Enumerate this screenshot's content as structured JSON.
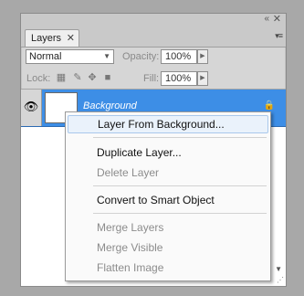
{
  "panel": {
    "tab_label": "Layers",
    "tab_close": "✕",
    "collapse_glyph": "«",
    "close_glyph": "✕",
    "menu_glyph": "▾≡"
  },
  "controls": {
    "blend_mode": "Normal",
    "opacity_label": "Opacity:",
    "opacity_value": "100%",
    "lock_label": "Lock:",
    "fill_label": "Fill:",
    "fill_value": "100%"
  },
  "layers": [
    {
      "name": "Background",
      "visible": true,
      "locked": true,
      "selected": true
    }
  ],
  "context_menu": {
    "items": [
      {
        "label": "Layer From Background...",
        "enabled": true,
        "highlighted": true
      },
      {
        "label": "Duplicate Layer...",
        "enabled": true
      },
      {
        "label": "Delete Layer",
        "enabled": false
      },
      {
        "label": "Convert to Smart Object",
        "enabled": true
      },
      {
        "label": "Merge Layers",
        "enabled": false
      },
      {
        "label": "Merge Visible",
        "enabled": false
      },
      {
        "label": "Flatten Image",
        "enabled": false
      }
    ]
  },
  "colors": {
    "selection": "#3d8ee6",
    "panel_bg": "#d6d6d6",
    "desktop_bg": "#a8a8a8"
  },
  "icons": [
    "eye-icon",
    "lock-icon",
    "move-icon",
    "brush-icon",
    "transparency-lock-icon",
    "menu-icon",
    "close-icon",
    "collapse-icon"
  ]
}
